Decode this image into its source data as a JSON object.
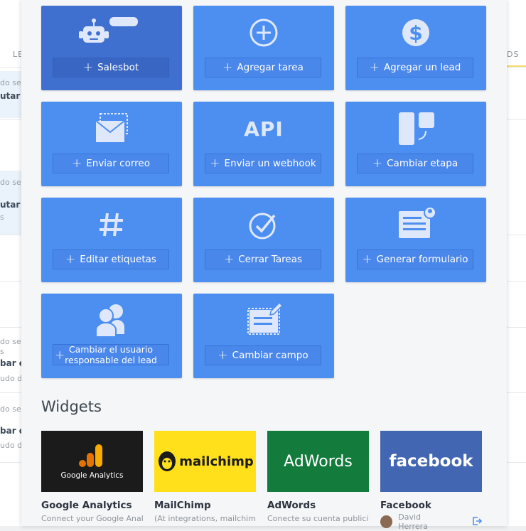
{
  "background": {
    "tab_left": "LE",
    "tab_right": "DS",
    "fragments": [
      {
        "label": "do se",
        "bold": false
      },
      {
        "label": "utar S",
        "bold": true
      },
      {
        "label": "do se",
        "bold": false
      },
      {
        "label": "utar S",
        "bold": true
      },
      {
        "label": "s",
        "bold": false
      },
      {
        "label": "do se",
        "bold": false
      },
      {
        "label": "s",
        "bold": false
      },
      {
        "label": "bar e",
        "bold": true
      },
      {
        "label": "udo d",
        "bold": false
      },
      {
        "label": "do se",
        "bold": false
      },
      {
        "label": "bar e",
        "bold": true
      },
      {
        "label": "udo d",
        "bold": false
      }
    ]
  },
  "actions": [
    {
      "label": "Salesbot",
      "icon": "robot-icon"
    },
    {
      "label": "Agregar tarea",
      "icon": "add-circle-icon"
    },
    {
      "label": "Agregar un lead",
      "icon": "dollar-icon"
    },
    {
      "label": "Enviar correo",
      "icon": "envelope-icon"
    },
    {
      "label": "Enviar un webhook",
      "icon": "api-icon",
      "icon_text": "API"
    },
    {
      "label": "Cambiar etapa",
      "icon": "pipeline-stage-icon"
    },
    {
      "label": "Editar etiquetas",
      "icon": "hashtag-icon"
    },
    {
      "label": "Cerrar Tareas",
      "icon": "check-circle-icon"
    },
    {
      "label": "Generar formulario",
      "icon": "form-icon"
    },
    {
      "label": "Cambiar el usuario responsable del lead",
      "icon": "users-icon"
    },
    {
      "label": "Cambiar campo",
      "icon": "edit-field-icon"
    }
  ],
  "widgets_title": "Widgets",
  "widgets": [
    {
      "name": "Google Analytics",
      "desc": "Connect your Google Anal...",
      "logo_text": "Google Analytics",
      "bg": "#1b1b1b"
    },
    {
      "name": "MailChimp",
      "desc": "(At integrations, mailchim...",
      "logo_text": "mailchimp",
      "bg": "#ffe01b"
    },
    {
      "name": "AdWords",
      "desc": "Conecte su cuenta publici...",
      "logo_text": "AdWords",
      "bg": "#137b3c"
    },
    {
      "name": "Facebook",
      "desc": "David Herrera",
      "logo_text": "facebook",
      "bg": "#4266b2"
    }
  ],
  "colors": {
    "card": "#4d8ff0",
    "salesbot_card": "#3f6fcf",
    "accent_yellow": "#f5d96b"
  }
}
